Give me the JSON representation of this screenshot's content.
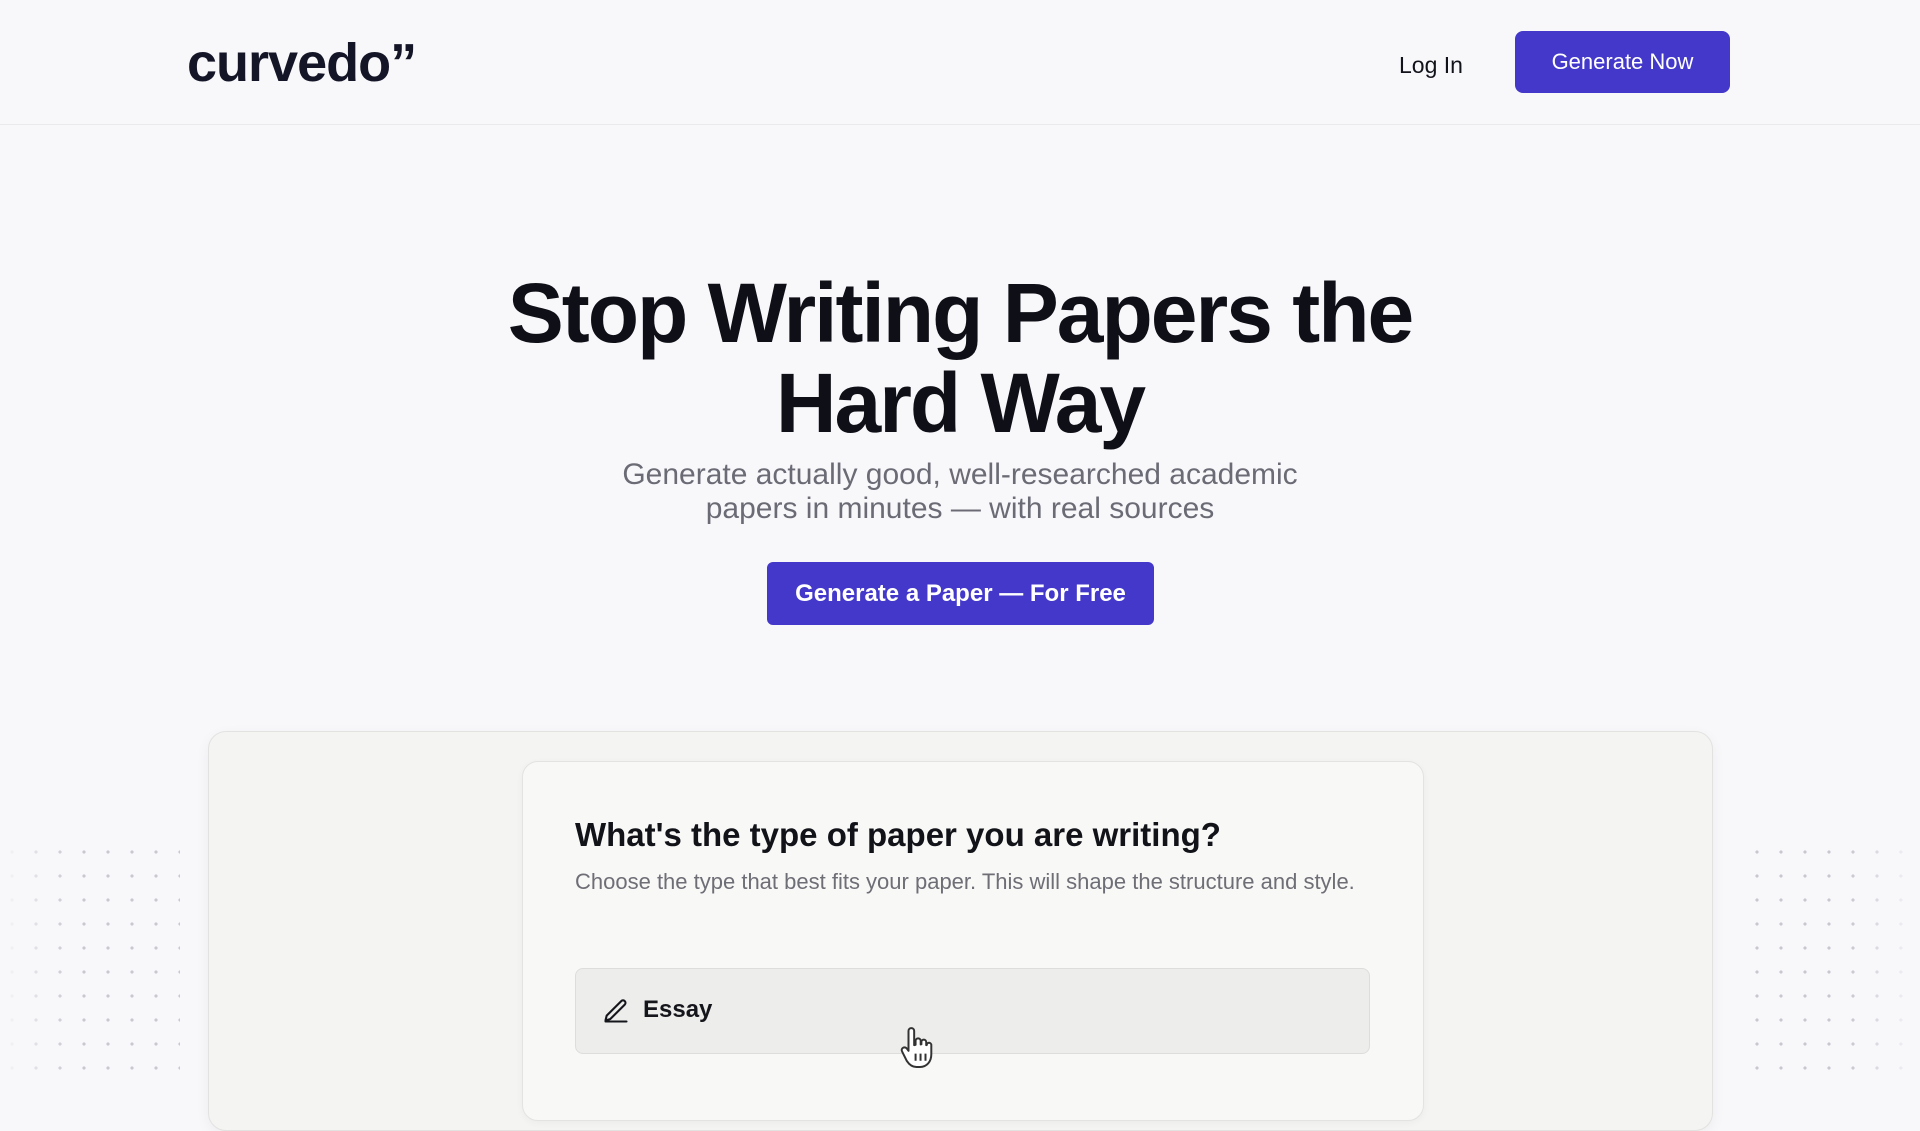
{
  "header": {
    "logo": "curvedo”",
    "login_label": "Log In",
    "cta_label": "Generate Now"
  },
  "hero": {
    "title_line1": "Stop Writing Papers the",
    "title_line2": "Hard Way",
    "subtitle_line1": "Generate actually good, well-researched academic",
    "subtitle_line2": "papers in minutes — with real sources",
    "cta_label": "Generate a Paper — For Free"
  },
  "preview": {
    "question": "What's the type of paper you are writing?",
    "description": "Choose the type that best fits your paper. This will shape the structure and style.",
    "options": [
      {
        "label": "Essay",
        "icon": "pencil-icon"
      }
    ]
  },
  "colors": {
    "accent": "#4338ca",
    "background": "#f8f8fb",
    "text": "#12131a",
    "muted": "#6b6b75"
  }
}
